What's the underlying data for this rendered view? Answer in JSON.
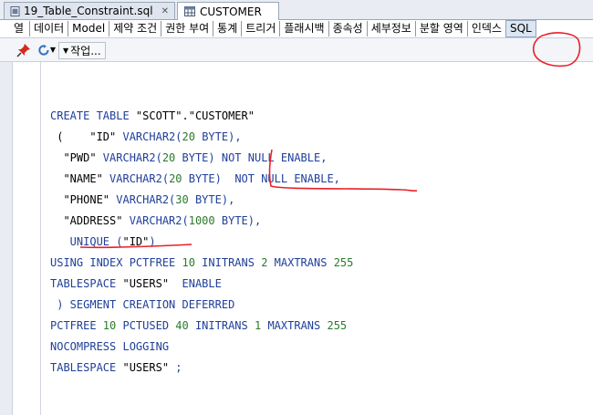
{
  "tabs": [
    {
      "label": "19_Table_Constraint.sql",
      "icon": "sql-file-icon"
    },
    {
      "label": "CUSTOMER",
      "icon": "table-icon"
    }
  ],
  "subtabs": [
    "열",
    "데이터",
    "Model",
    "제약 조건",
    "권한 부여",
    "통계",
    "트리거",
    "플래시백",
    "종속성",
    "세부정보",
    "분할 영역",
    "인덱스",
    "SQL"
  ],
  "selected_subtab": "SQL",
  "toolbar": {
    "action_label": "작업..."
  },
  "sql_lines": [
    [
      {
        "t": "CREATE TABLE ",
        "c": "kw"
      },
      {
        "t": "\"SCOTT\".\"CUSTOMER\"",
        "c": "str"
      }
    ],
    [
      {
        "t": " (    \"ID\" ",
        "c": "str"
      },
      {
        "t": "VARCHAR2(",
        "c": "kw"
      },
      {
        "t": "20",
        "c": "num"
      },
      {
        "t": " BYTE),",
        "c": "kw"
      }
    ],
    [
      {
        "t": "  \"PWD\" ",
        "c": "str"
      },
      {
        "t": "VARCHAR2(",
        "c": "kw"
      },
      {
        "t": "20",
        "c": "num"
      },
      {
        "t": " BYTE) NOT NULL ENABLE,",
        "c": "kw"
      }
    ],
    [
      {
        "t": "  \"NAME\" ",
        "c": "str"
      },
      {
        "t": "VARCHAR2(",
        "c": "kw"
      },
      {
        "t": "20",
        "c": "num"
      },
      {
        "t": " BYTE)  NOT NULL ENABLE,",
        "c": "kw"
      }
    ],
    [
      {
        "t": "  \"PHONE\" ",
        "c": "str"
      },
      {
        "t": "VARCHAR2(",
        "c": "kw"
      },
      {
        "t": "30",
        "c": "num"
      },
      {
        "t": " BYTE),",
        "c": "kw"
      }
    ],
    [
      {
        "t": "  \"ADDRESS\" ",
        "c": "str"
      },
      {
        "t": "VARCHAR2(",
        "c": "kw"
      },
      {
        "t": "1000",
        "c": "num"
      },
      {
        "t": " BYTE),",
        "c": "kw"
      }
    ],
    [
      {
        "t": "   UNIQUE (",
        "c": "kw"
      },
      {
        "t": "\"ID\"",
        "c": "str"
      },
      {
        "t": ")",
        "c": "kw"
      }
    ],
    [
      {
        "t": "USING INDEX PCTFREE ",
        "c": "kw"
      },
      {
        "t": "10",
        "c": "num"
      },
      {
        "t": " INITRANS ",
        "c": "kw"
      },
      {
        "t": "2",
        "c": "num"
      },
      {
        "t": " MAXTRANS ",
        "c": "kw"
      },
      {
        "t": "255",
        "c": "num"
      }
    ],
    [
      {
        "t": "TABLESPACE ",
        "c": "kw"
      },
      {
        "t": "\"USERS\"",
        "c": "str"
      },
      {
        "t": "  ENABLE",
        "c": "kw"
      }
    ],
    [
      {
        "t": " ) SEGMENT CREATION DEFERRED",
        "c": "kw"
      }
    ],
    [
      {
        "t": "PCTFREE ",
        "c": "kw"
      },
      {
        "t": "10",
        "c": "num"
      },
      {
        "t": " PCTUSED ",
        "c": "kw"
      },
      {
        "t": "40",
        "c": "num"
      },
      {
        "t": " INITRANS ",
        "c": "kw"
      },
      {
        "t": "1",
        "c": "num"
      },
      {
        "t": " MAXTRANS ",
        "c": "kw"
      },
      {
        "t": "255",
        "c": "num"
      }
    ],
    [
      {
        "t": "NOCOMPRESS LOGGING",
        "c": "kw"
      }
    ],
    [
      {
        "t": "TABLESPACE ",
        "c": "kw"
      },
      {
        "t": "\"USERS\"",
        "c": "str"
      },
      {
        "t": " ;",
        "c": "kw"
      }
    ]
  ],
  "colors": {
    "keyword": "#1f3f9a",
    "number": "#2b7a2b",
    "annotation": "#e8202a"
  }
}
